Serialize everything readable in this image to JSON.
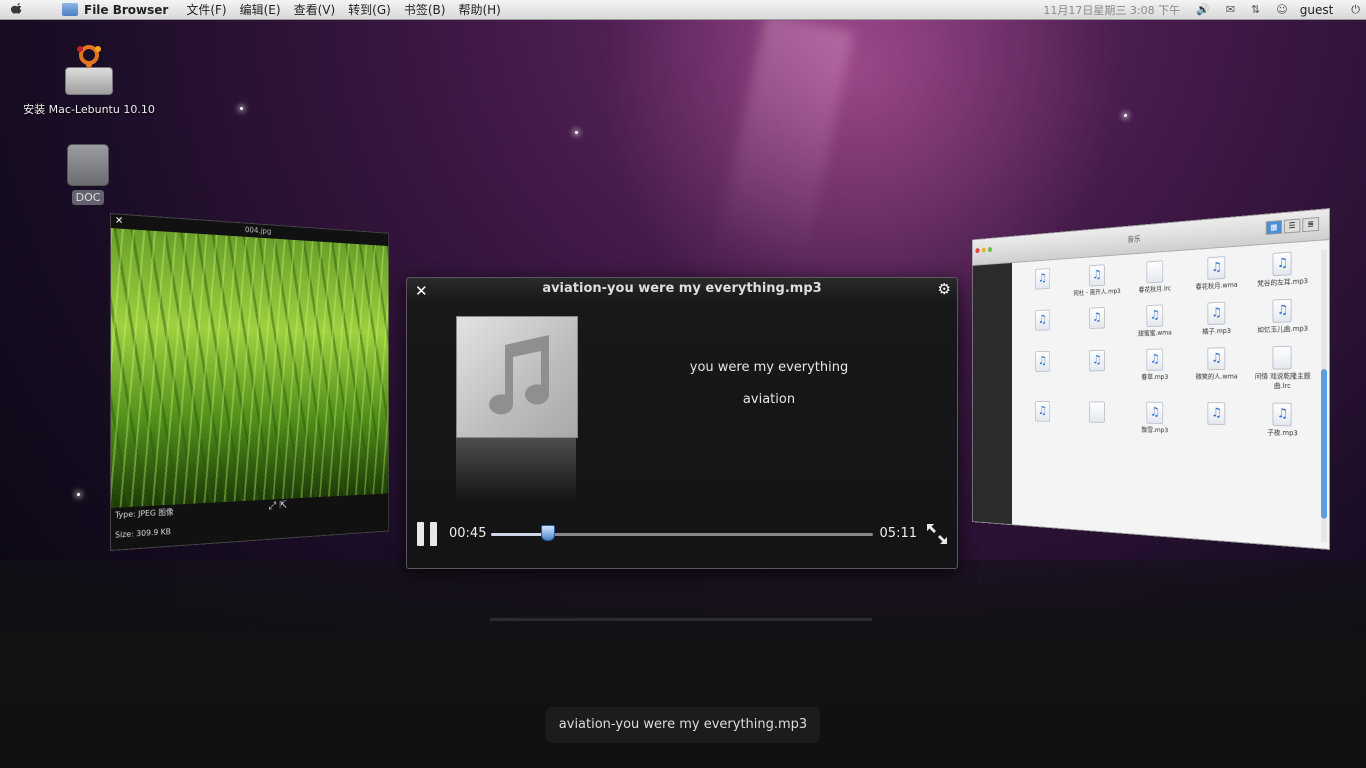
{
  "menubar": {
    "app_name": "File Browser",
    "menus": [
      "文件(F)",
      "编辑(E)",
      "查看(V)",
      "转到(G)",
      "书签(B)",
      "帮助(H)"
    ],
    "clock": "11月17日星期三  3:08 下午",
    "user": "guest"
  },
  "desktop": {
    "icons": [
      {
        "label": "安装 Mac-Lebuntu 10.10"
      },
      {
        "label": "DOC"
      }
    ]
  },
  "image_viewer": {
    "title": "004.jpg",
    "type_text": "Type: JPEG 图像",
    "size_text": "Size: 309.9 KB"
  },
  "file_browser": {
    "title": "音乐",
    "files": [
      {
        "name": "",
        "kind": "mp3"
      },
      {
        "name": "阿杜 - 离开人.mp3",
        "kind": "mp3"
      },
      {
        "name": "春花秋月.lrc",
        "kind": "plain"
      },
      {
        "name": "春花秋月.wma",
        "kind": "mp3"
      },
      {
        "name": "梵谷的左耳.mp3",
        "kind": "mp3"
      },
      {
        "name": "",
        "kind": "mp3"
      },
      {
        "name": "",
        "kind": "mp3"
      },
      {
        "name": "甜蜜蜜.wma",
        "kind": "mp3"
      },
      {
        "name": "橘子.mp3",
        "kind": "mp3"
      },
      {
        "name": "如忆玉儿曲.mp3",
        "kind": "mp3"
      },
      {
        "name": "",
        "kind": "mp3"
      },
      {
        "name": "",
        "kind": "mp3"
      },
      {
        "name": "春草.mp3",
        "kind": "mp3"
      },
      {
        "name": "微笑的人.wma",
        "kind": "mp3"
      },
      {
        "name": "问情 戏说乾隆主题曲.lrc",
        "kind": "plain"
      },
      {
        "name": "",
        "kind": "mp3"
      },
      {
        "name": "",
        "kind": "plain"
      },
      {
        "name": "飘雪.mp3",
        "kind": "mp3"
      },
      {
        "name": "",
        "kind": "mp3"
      },
      {
        "name": "子夜.mp3",
        "kind": "mp3"
      }
    ]
  },
  "player": {
    "file_name": "aviation-you were my everything.mp3",
    "song_title": "you were my everything",
    "artist": "aviation",
    "current_time": "00:45",
    "total_time": "05:11",
    "progress": 0.15
  },
  "tooltip": {
    "text": "aviation-you were my everything.mp3"
  },
  "colors": {
    "seek_knob": "#4f88cc",
    "file_icon_note": "#2f6fcf",
    "accent_blue": "#4d8fd6"
  }
}
